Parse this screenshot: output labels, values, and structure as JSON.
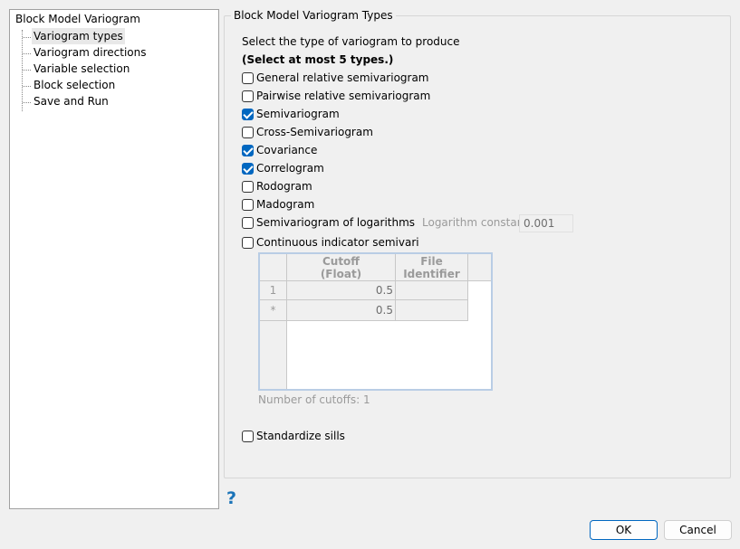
{
  "tree": {
    "root": "Block Model Variogram",
    "items": [
      "Variogram types",
      "Variogram directions",
      "Variable selection",
      "Block selection",
      "Save and Run"
    ],
    "selected": "Variogram types"
  },
  "group": {
    "title": "Block Model Variogram Types",
    "instruction": "Select the type of variogram to produce",
    "limit": "(Select at most 5 types.)"
  },
  "types": [
    {
      "label": "General relative semivariogram",
      "checked": false
    },
    {
      "label": "Pairwise relative semivariogram",
      "checked": false
    },
    {
      "label": "Semivariogram",
      "checked": true
    },
    {
      "label": "Cross-Semivariogram",
      "checked": false
    },
    {
      "label": "Covariance",
      "checked": true
    },
    {
      "label": "Correlogram",
      "checked": true
    },
    {
      "label": "Rodogram",
      "checked": false
    },
    {
      "label": "Madogram",
      "checked": false
    },
    {
      "label": "Semivariogram of logarithms",
      "checked": false
    },
    {
      "label": "Continuous indicator semivariogra",
      "checked": false
    }
  ],
  "log_constant": {
    "label": "Logarithm constant",
    "value": "0.001"
  },
  "cutoff_table": {
    "headers": [
      "Cutoff\n(Float)",
      "File\nIdentifier"
    ],
    "rows": [
      {
        "row": "1",
        "cutoff": "0.5",
        "file": ""
      },
      {
        "row": "*",
        "cutoff": "0.5",
        "file": ""
      }
    ],
    "count_label": "Number of cutoffs: 1"
  },
  "standardize": {
    "label": "Standardize sills",
    "checked": false
  },
  "buttons": {
    "ok": "OK",
    "cancel": "Cancel",
    "help": "?"
  },
  "colors": {
    "accent": "#0067c0",
    "help": "#1a73b8"
  }
}
